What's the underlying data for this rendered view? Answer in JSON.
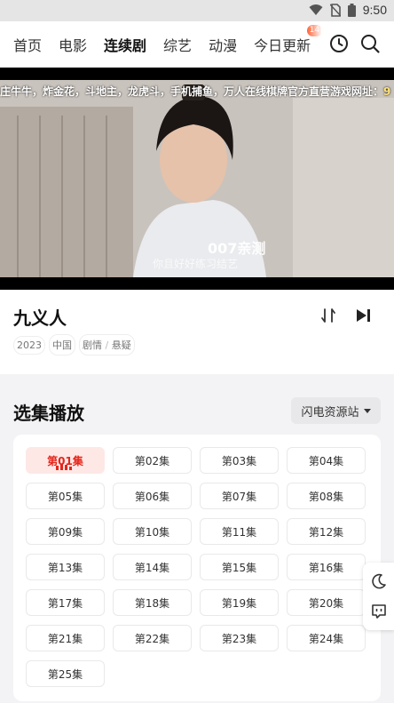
{
  "status_bar": {
    "time": "9:50"
  },
  "nav": {
    "tabs": [
      {
        "label": "首页"
      },
      {
        "label": "电影"
      },
      {
        "label": "连续剧",
        "active": true
      },
      {
        "label": "综艺"
      },
      {
        "label": "动漫"
      },
      {
        "label": "今日更新",
        "badge": "14"
      }
    ],
    "icons": [
      "history-icon",
      "search-icon"
    ]
  },
  "player": {
    "marquee_text": "庄牛牛，炸金花，斗地主，龙虎斗，手机捕鱼，万人在线棋牌官方直营游戏网址：",
    "marquee_tail": "9",
    "watermark": "007亲测",
    "subtitle": "你且好好练习结艺"
  },
  "show": {
    "title": "九义人",
    "year": "2023",
    "region": "中国",
    "genres": [
      "剧情",
      "悬疑"
    ],
    "genre_sep": "/"
  },
  "episodes_section": {
    "title": "选集播放",
    "source": "闪电资源站",
    "episodes": [
      "第01集",
      "第02集",
      "第03集",
      "第04集",
      "第05集",
      "第06集",
      "第07集",
      "第08集",
      "第09集",
      "第10集",
      "第11集",
      "第12集",
      "第13集",
      "第14集",
      "第15集",
      "第16集",
      "第17集",
      "第18集",
      "第19集",
      "第20集",
      "第21集",
      "第22集",
      "第23集",
      "第24集",
      "第25集"
    ],
    "active_index": 0
  },
  "colors": {
    "accent": "#ffce3d",
    "active_red": "#e4261b",
    "badge": "#ff5a2c"
  }
}
